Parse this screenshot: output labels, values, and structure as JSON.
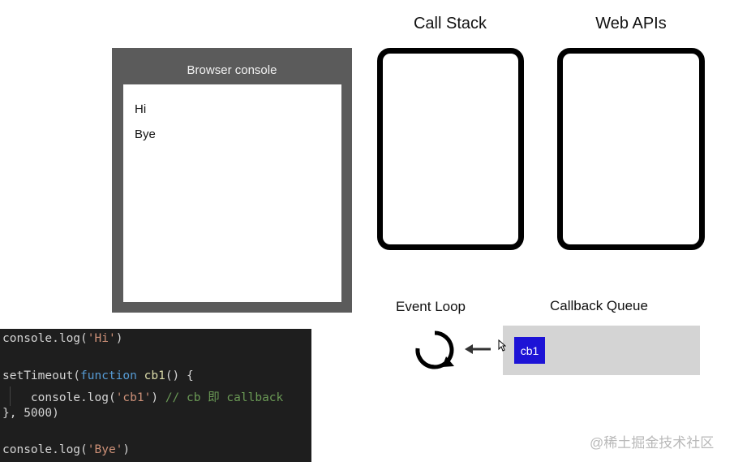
{
  "console": {
    "title": "Browser console",
    "lines": [
      "Hi",
      "Bye"
    ]
  },
  "call_stack": {
    "title": "Call Stack"
  },
  "web_apis": {
    "title": "Web APIs"
  },
  "event_loop": {
    "title": "Event Loop",
    "icon": "refresh-icon",
    "arrow": "left-arrow-icon"
  },
  "callback_queue": {
    "title": "Callback Queue",
    "items": [
      "cb1"
    ]
  },
  "code": {
    "line1": [
      "console.log(",
      "'Hi'",
      ")"
    ],
    "line2": [
      "setTimeout(",
      "function",
      " ",
      "cb1",
      "() {"
    ],
    "line3": [
      "    console.log(",
      "'cb1'",
      ") ",
      "// cb 即 callback"
    ],
    "line4": [
      "}, 5000)"
    ],
    "line5": [
      "console.log(",
      "'Bye'",
      ")"
    ]
  },
  "watermark": "@稀土掘金技术社区",
  "colors": {
    "console_bg": "#5b5b5b",
    "queue_bg": "#d4d4d4",
    "cb_block": "#1d13d6",
    "code_bg": "#1e1e1e"
  }
}
